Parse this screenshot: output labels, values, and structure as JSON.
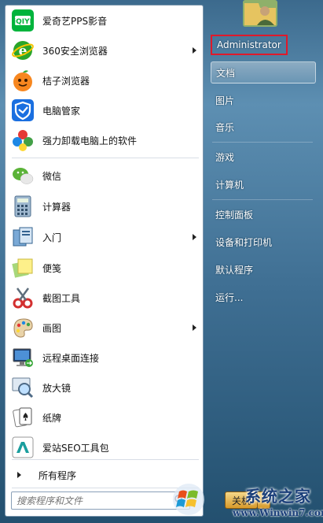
{
  "programs": [
    {
      "label": "爱奇艺PPS影音",
      "icon": "iqiyi-icon",
      "has_submenu": false
    },
    {
      "label": "360安全浏览器",
      "icon": "360-browser-icon",
      "has_submenu": true
    },
    {
      "label": "桔子浏览器",
      "icon": "orange-browser-icon",
      "has_submenu": false
    },
    {
      "label": "电脑管家",
      "icon": "pc-manager-icon",
      "has_submenu": false
    },
    {
      "label": "强力卸载电脑上的软件",
      "icon": "uninstall-icon",
      "has_submenu": false
    },
    {
      "label": "微信",
      "icon": "wechat-icon",
      "has_submenu": false
    },
    {
      "label": "计算器",
      "icon": "calculator-icon",
      "has_submenu": false
    },
    {
      "label": "入门",
      "icon": "getting-started-icon",
      "has_submenu": true
    },
    {
      "label": "便笺",
      "icon": "sticky-notes-icon",
      "has_submenu": false
    },
    {
      "label": "截图工具",
      "icon": "snipping-tool-icon",
      "has_submenu": false
    },
    {
      "label": "画图",
      "icon": "paint-icon",
      "has_submenu": true
    },
    {
      "label": "远程桌面连接",
      "icon": "remote-desktop-icon",
      "has_submenu": false
    },
    {
      "label": "放大镜",
      "icon": "magnifier-icon",
      "has_submenu": false
    },
    {
      "label": "纸牌",
      "icon": "solitaire-icon",
      "has_submenu": false
    },
    {
      "label": "爱站SEO工具包",
      "icon": "seo-toolkit-icon",
      "has_submenu": false
    }
  ],
  "all_programs": "所有程序",
  "search": {
    "placeholder": "搜索程序和文件"
  },
  "right_pane": {
    "user": "Administrator",
    "documents": "文档",
    "pictures": "图片",
    "music": "音乐",
    "games": "游戏",
    "computer": "计算机",
    "control_panel": "控制面板",
    "devices_printers": "设备和打印机",
    "default_programs": "默认程序",
    "run": "运行..."
  },
  "shutdown_label": "关机",
  "watermark": {
    "title": "系统之家",
    "url": "www.Winwin7.com"
  },
  "colors": {
    "highlight_border": "#e0192a",
    "frame": "#3f6f93"
  }
}
